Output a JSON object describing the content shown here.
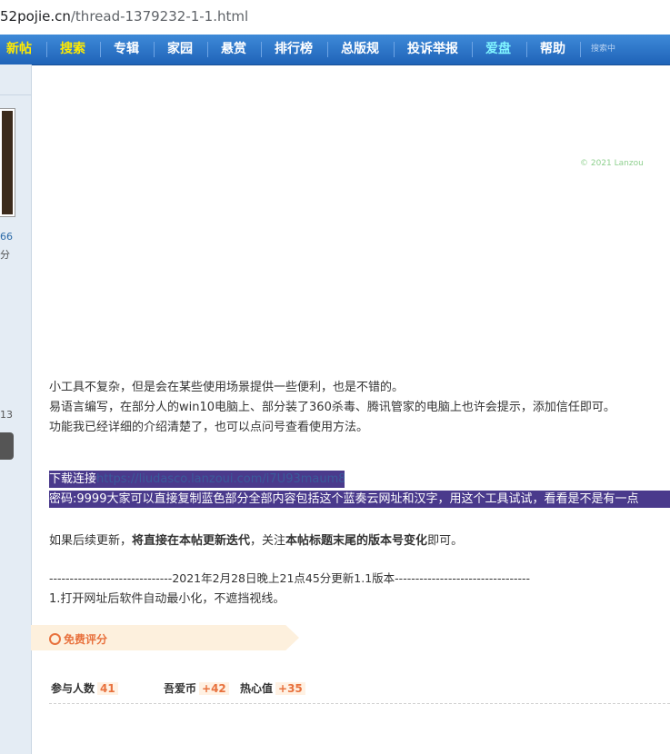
{
  "address_bar": {
    "host": "52pojie.cn",
    "path": "/thread-1379232-1-1.html"
  },
  "nav": {
    "items": [
      {
        "label": "新帖",
        "style": "y"
      },
      {
        "label": "搜索",
        "style": "y"
      },
      {
        "label": "专辑",
        "style": ""
      },
      {
        "label": "家园",
        "style": ""
      },
      {
        "label": "悬赏",
        "style": ""
      },
      {
        "label": "排行榜",
        "style": ""
      },
      {
        "label": "总版规",
        "style": ""
      },
      {
        "label": "投诉举报",
        "style": ""
      },
      {
        "label": "爱盘",
        "style": "c"
      },
      {
        "label": "帮助",
        "style": ""
      }
    ],
    "mini": "搜索中"
  },
  "sidebar": {
    "num1": "66",
    "txt1": "分",
    "num2": "13"
  },
  "post": {
    "copyright": "© 2021 Lanzou",
    "lines": [
      "小工具不复杂，但是会在某些使用场景提供一些便利，也是不错的。",
      "易语言编写，在部分人的win10电脑上、部分装了360杀毒、腾讯管家的电脑上也许会提示，添加信任即可。",
      "功能我已经详细的介绍清楚了，也可以点问号查看使用方法。"
    ],
    "download_label": "下载连接",
    "download_url": "https://liudasco.lanzoui.com/i7U93maum8h",
    "password_line": "密码:9999大家可以直接复制蓝色部分全部内容包括这个蓝奏云网址和汉字，用这个工具试试，看看是不是有一点",
    "update_note": {
      "pre": "如果后续更新，",
      "b1": "将直接在本帖更新迭代",
      "mid": "，关注",
      "b2": "本帖标题末尾的版本号变化",
      "post": "即可。"
    },
    "version_line": "------------------------------2021年2月28日晚上21点45分更新1.1版本---------------------------------",
    "change1": "1.打开网址后软件自动最小化，不遮挡视线。"
  },
  "rating": {
    "label": "免费评分",
    "participants_label": "参与人数",
    "participants": "41",
    "coin_label": "吾爱币",
    "coin": "+42",
    "heart_label": "热心值",
    "heart": "+35"
  }
}
